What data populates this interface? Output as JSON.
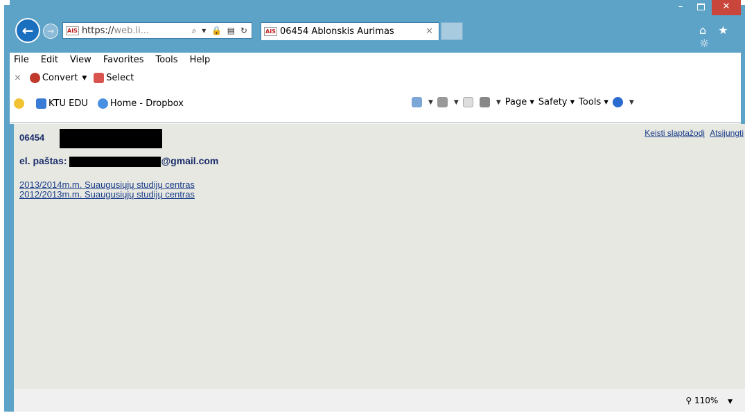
{
  "address_bar": {
    "site_badge": "AIS",
    "url_prefix": "https://",
    "url_rest": "web.li...",
    "icons": "⌕ ▾ 🔒 ▤ ↻"
  },
  "tab": {
    "badge": "AIS",
    "title": "06454 Ablonskis Aurimas",
    "close": "✕"
  },
  "window_controls": {
    "minimize": "–",
    "close": "✕"
  },
  "right_icons": "⌂ ★ ☼",
  "menu": [
    "File",
    "Edit",
    "View",
    "Favorites",
    "Tools",
    "Help"
  ],
  "convert_bar": {
    "close": "×",
    "convert": "Convert",
    "select": "Select"
  },
  "favorites": [
    {
      "label": "",
      "icon": "favorites-star-icon"
    },
    {
      "label": "KTU EDU",
      "icon": "ktu-icon"
    },
    {
      "label": "Home - Dropbox",
      "icon": "dropbox-icon"
    }
  ],
  "command_bar": {
    "page": "Page",
    "safety": "Safety",
    "tools": "Tools"
  },
  "page": {
    "user_id": "06454",
    "email_label": "el. paštas:",
    "email_suffix": "@gmail.com",
    "change_password": "Keisti slaptažodį",
    "logout": "Atsijungti",
    "links": [
      "2013/2014m.m. Suaugusiųjų studijų centras",
      "2012/2013m.m. Suaugusiųjų studijų centras"
    ]
  },
  "status": {
    "zoom": "110%"
  },
  "colors": {
    "titlebar": "#5da3c8",
    "content_bg": "#e7e8e2",
    "link": "#1a3d8a"
  }
}
